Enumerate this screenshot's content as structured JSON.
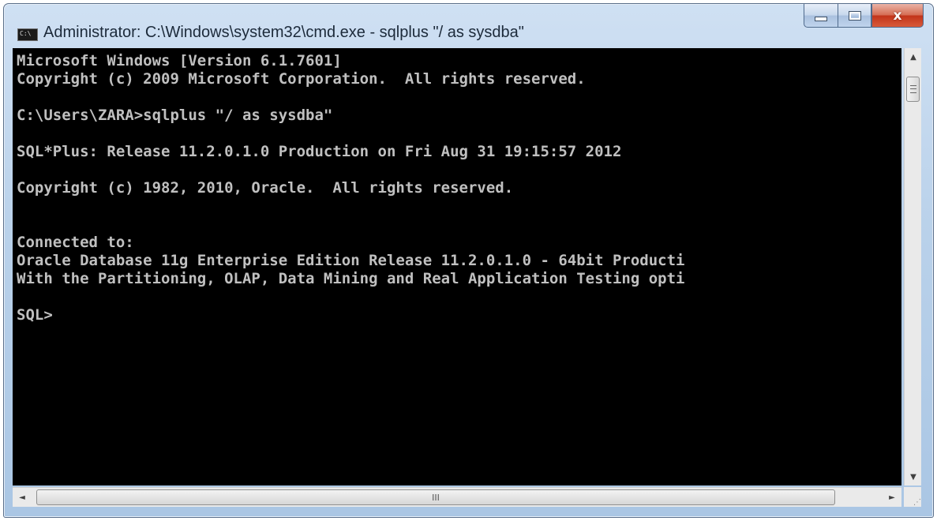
{
  "window": {
    "title": "Administrator: C:\\Windows\\system32\\cmd.exe - sqlplus  \"/ as sysdba\"",
    "icon": "cmd-icon",
    "buttons": {
      "minimize": "minimize-icon",
      "maximize": "maximize-icon",
      "close_label": "x"
    }
  },
  "console": {
    "lines": [
      "Microsoft Windows [Version 6.1.7601]",
      "Copyright (c) 2009 Microsoft Corporation.  All rights reserved.",
      "",
      "C:\\Users\\ZARA>sqlplus \"/ as sysdba\"",
      "",
      "SQL*Plus: Release 11.2.0.1.0 Production on Fri Aug 31 19:15:57 2012",
      "",
      "Copyright (c) 1982, 2010, Oracle.  All rights reserved.",
      "",
      "",
      "Connected to:",
      "Oracle Database 11g Enterprise Edition Release 11.2.0.1.0 - 64bit Producti",
      "With the Partitioning, OLAP, Data Mining and Real Application Testing opti",
      "",
      "SQL>"
    ],
    "text_color": "#c0c0c0",
    "background": "#000000"
  },
  "scrollbars": {
    "up_arrow": "▲",
    "down_arrow": "▼",
    "left_arrow": "◄",
    "right_arrow": "►",
    "h_thumb_grip": "III"
  }
}
